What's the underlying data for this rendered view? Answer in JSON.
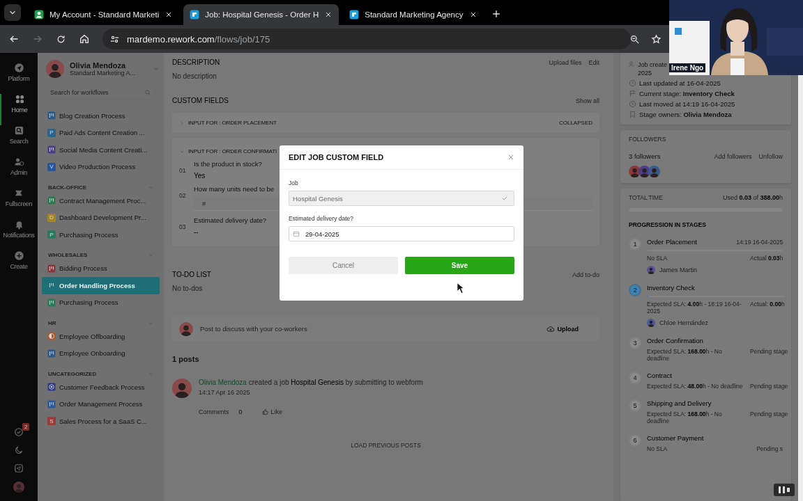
{
  "browser": {
    "tabs": [
      {
        "title": "My Account - Standard Marketi",
        "selected": false
      },
      {
        "title": "Job: Hospital Genesis - Order H",
        "selected": true
      },
      {
        "title": "Standard Marketing Agency",
        "selected": false
      }
    ],
    "url_host": "mardemo.rework.com",
    "url_path": "/flows/job/175"
  },
  "video_call": {
    "participant": "Irene Ngo",
    "kind": "picture"
  },
  "rail": {
    "items": [
      {
        "label": "Platform",
        "selected": false
      },
      {
        "label": "Home",
        "selected": true
      },
      {
        "label": "Search",
        "selected": false
      },
      {
        "label": "Admin",
        "selected": false
      },
      {
        "label": "Fullscreen",
        "selected": false
      },
      {
        "label": "Notifications",
        "selected": false
      },
      {
        "label": "Create",
        "selected": false
      }
    ],
    "task_badge": "2"
  },
  "sidebar": {
    "user_name": "Olivia Mendoza",
    "org": "Standard Marketing A...",
    "search_placeholder": "Search for workflows",
    "groups": [
      {
        "items": [
          {
            "label": "Blog Creation Process",
            "kind": "board",
            "color": "#2a5a8a",
            "selected": false
          },
          {
            "label": "Paid Ads Content Creation ...",
            "kind": "letter",
            "letter": "P",
            "color": "#2a6491",
            "selected": false
          },
          {
            "label": "Social Media Content Creati...",
            "kind": "board",
            "color": "#483f86",
            "selected": false
          },
          {
            "label": "Video Production Process",
            "kind": "letter",
            "letter": "V",
            "color": "#27579a",
            "selected": false
          }
        ]
      },
      {
        "title": "BACK-OFFICE",
        "items": [
          {
            "label": "Contract Management Proc...",
            "kind": "board",
            "color": "#2e7a50",
            "selected": false
          },
          {
            "label": "Dashboard Development Pr...",
            "kind": "letter",
            "letter": "D",
            "color": "#a8861e",
            "selected": false
          },
          {
            "label": "Purchasing Process",
            "kind": "letter",
            "letter": "P",
            "color": "#2a7a62",
            "selected": false
          }
        ]
      },
      {
        "title": "WHOLESALES",
        "items": [
          {
            "label": "Bidding Process",
            "kind": "board",
            "color": "#8a3a3e",
            "selected": false
          },
          {
            "label": "Order Handling Process",
            "kind": "board",
            "color": "#1f6f78",
            "selected": true
          },
          {
            "label": "Purchasing Process",
            "kind": "board",
            "color": "#2a7a5a",
            "selected": false
          }
        ]
      },
      {
        "title": "HR",
        "items": [
          {
            "label": "Employee Offboarding",
            "kind": "half",
            "color": "#b0562a",
            "selected": false
          },
          {
            "label": "Employee Onboarding",
            "kind": "board",
            "color": "#2a5a8a",
            "selected": false
          }
        ]
      },
      {
        "title": "UNCATEGORIZED",
        "items": [
          {
            "label": "Customer Feedback Process",
            "kind": "target",
            "color": "#2b3b88",
            "selected": false
          },
          {
            "label": "Order Management Process",
            "kind": "board",
            "color": "#2a5a96",
            "selected": false
          },
          {
            "label": "Sales Process for a SaaS C...",
            "kind": "letter",
            "letter": "S",
            "color": "#a03a3a",
            "selected": false
          }
        ]
      }
    ]
  },
  "description": {
    "title": "DESCRIPTION",
    "actions": [
      "Upload files",
      "Edit"
    ],
    "text": "No description"
  },
  "custom_fields": {
    "title": "CUSTOM FIELDS",
    "action": "Show all",
    "sections": [
      {
        "title": "INPUT FOR : ORDER PLACEMENT",
        "status": "COLLAPSED",
        "expanded": false
      },
      {
        "title": "INPUT FOR : ORDER CONFIRMATI",
        "expanded": true,
        "fields": [
          {
            "number": "01",
            "question": "Is the product in stock?",
            "value": "Yes"
          },
          {
            "number": "02",
            "question": "How many units need to be",
            "placeholder": "#"
          },
          {
            "number": "03",
            "question": "Estimated delivery date?",
            "value": "--"
          }
        ]
      }
    ]
  },
  "todo": {
    "title": "TO-DO LIST",
    "action": "Add to-do",
    "empty": "No to-dos"
  },
  "composer": {
    "placeholder": "Post to discuss with your co-workers",
    "upload": "Upload"
  },
  "posts": {
    "count": "1 posts",
    "items": [
      {
        "author": "Olivia Mendoza",
        "action": "created a job",
        "job": "Hospital Genesis",
        "tail": "by submitting to webform",
        "time": "14:17 Apr 16 2025",
        "comments": "Comments",
        "comment_count": "0",
        "like": "Like"
      }
    ],
    "load_more": "LOAD PREVIOUS POSTS"
  },
  "job_info": [
    {
      "kind": "person",
      "lines": [
        "Job create",
        "2025"
      ]
    },
    {
      "kind": "clock",
      "lines": [
        "Last updated at 16-04-2025"
      ]
    },
    {
      "kind": "flag",
      "lines": [
        "Current stage: **Inventory Check**"
      ]
    },
    {
      "kind": "clock",
      "lines": [
        "Last moved at 14:19 16-04-2025"
      ]
    },
    {
      "kind": "bookmark",
      "lines": [
        "Stage owners: **Olivia Mendoza**"
      ]
    }
  ],
  "followers": {
    "title": "FOLLOWERS",
    "count": "3 followers",
    "actions": [
      "Add followers",
      "Unfollow"
    ],
    "avatars": [
      {
        "color": "#8a3a3a"
      },
      {
        "color": "#4a3f86"
      },
      {
        "color": "#3a5a8a"
      }
    ]
  },
  "total_time": {
    "title": "TOTAL TIME",
    "reading": "Used **0.03** of **388.00**h",
    "level": 0
  },
  "stages": {
    "title": "PROGRESSION IN STAGES",
    "items": [
      {
        "number": "1",
        "name": "Order Placement",
        "current": false,
        "time": "14:19 16-04-2025",
        "level": 0,
        "sla": "No SLA",
        "right": "Actual  **0.03**h",
        "assignee": "James Martin"
      },
      {
        "number": "2",
        "name": "Inventory Check",
        "current": true,
        "level": 0.01,
        "sla": "Expected SLA: **4.00**h - 18:19 16-04-2025",
        "right": "Actual: **0.00**h",
        "assignee": "Chloe Hernández"
      },
      {
        "number": "3",
        "name": "Order Confirmation",
        "current": false,
        "sla": "Expected SLA: **168.00**h - No deadline",
        "right": "Pending stage"
      },
      {
        "number": "4",
        "name": "Contract",
        "current": false,
        "sla": "Expected SLA: **48.00**h - No deadline",
        "right": "Pending stage"
      },
      {
        "number": "5",
        "name": "Shipping and Delivery",
        "current": false,
        "sla": "Expected SLA: **168.00**h - No deadline",
        "right": "Pending stage"
      },
      {
        "number": "6",
        "name": "Customer Payment",
        "current": false,
        "sla": "No SLA",
        "right": "Pending s"
      }
    ]
  },
  "modal": {
    "title": "EDIT JOB CUSTOM FIELD",
    "fields": [
      {
        "label": "Job",
        "kind": "select",
        "value": "Hospital Genesis",
        "disabled": true
      },
      {
        "label": "Estimated delivery date?",
        "kind": "date",
        "value": "29-04-2025",
        "disabled": false
      }
    ],
    "buttons": [
      {
        "label": "Cancel",
        "primary": false
      },
      {
        "label": "Save",
        "primary": true
      }
    ]
  }
}
